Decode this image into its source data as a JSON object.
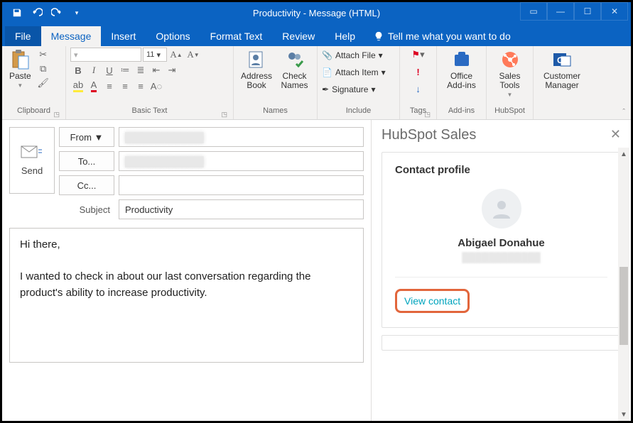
{
  "window": {
    "title": "Productivity  -  Message (HTML)"
  },
  "qat": {
    "icons": {
      "save": "save-icon",
      "undo": "undo-icon",
      "redo": "redo-icon"
    }
  },
  "tabs": {
    "file": "File",
    "message": "Message",
    "insert": "Insert",
    "options": "Options",
    "format_text": "Format Text",
    "review": "Review",
    "help": "Help",
    "tellme": "Tell me what you want to do"
  },
  "ribbon": {
    "clipboard": {
      "label": "Clipboard",
      "paste": "Paste"
    },
    "basic_text": {
      "label": "Basic Text",
      "font_name_placeholder": " ",
      "font_size": "11"
    },
    "names": {
      "label": "Names",
      "address_book": "Address Book",
      "check_names": "Check Names"
    },
    "include": {
      "label": "Include",
      "attach_file": "Attach File",
      "attach_item": "Attach Item",
      "signature": "Signature"
    },
    "tags": {
      "label": "Tags"
    },
    "addins": {
      "label": "Add-ins",
      "office_addins": "Office Add-ins"
    },
    "hubspot": {
      "label": "HubSpot",
      "sales_tools": "Sales Tools"
    },
    "blank": {
      "label": " ",
      "customer_manager": "Customer Manager"
    }
  },
  "compose": {
    "send": "Send",
    "from": "From",
    "to": "To...",
    "cc": "Cc...",
    "subject_label": "Subject",
    "subject_value": "Productivity",
    "body_line1": "Hi there,",
    "body_line2": "I wanted to check in about our last conversation regarding the product's ability to increase productivity."
  },
  "hubspot_panel": {
    "title": "HubSpot Sales",
    "contact_profile": "Contact profile",
    "name": "Abigael Donahue",
    "view_contact": "View contact"
  }
}
